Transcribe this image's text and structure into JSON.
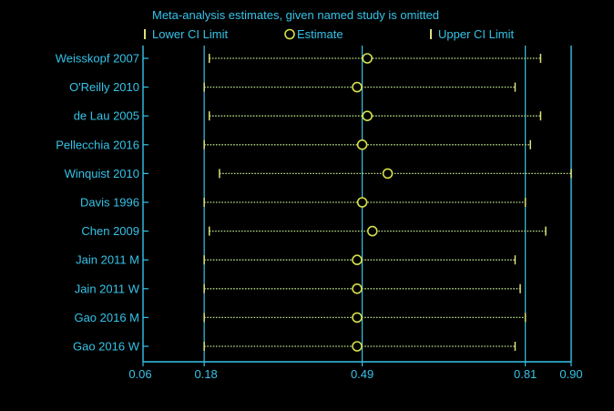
{
  "chart_data": {
    "type": "scatter",
    "title": "Meta-analysis estimates, given named study is omitted",
    "legend": {
      "placement": "top",
      "items": [
        {
          "label": "Lower CI Limit",
          "marker": "tick"
        },
        {
          "label": "Estimate",
          "marker": "circle"
        },
        {
          "label": "Upper CI Limit",
          "marker": "tick"
        }
      ]
    },
    "x_ticks": [
      {
        "value": 0.06,
        "label": "0.06"
      },
      {
        "value": 0.18,
        "label": "0.18"
      },
      {
        "value": 0.49,
        "label": "0.49"
      },
      {
        "value": 0.81,
        "label": "0.81"
      },
      {
        "value": 0.9,
        "label": "0.90"
      }
    ],
    "xlim": [
      0.06,
      0.9
    ],
    "reference_lines": [
      0.18,
      0.49,
      0.81
    ],
    "studies": [
      {
        "name": "Weisskopf 2007",
        "lower": 0.19,
        "estimate": 0.5,
        "upper": 0.84
      },
      {
        "name": "O'Reilly 2010",
        "lower": 0.18,
        "estimate": 0.48,
        "upper": 0.79
      },
      {
        "name": "de Lau 2005",
        "lower": 0.19,
        "estimate": 0.5,
        "upper": 0.84
      },
      {
        "name": "Pellecchia 2016",
        "lower": 0.18,
        "estimate": 0.49,
        "upper": 0.82
      },
      {
        "name": "Winquist 2010",
        "lower": 0.21,
        "estimate": 0.54,
        "upper": 0.9
      },
      {
        "name": "Davis 1996",
        "lower": 0.18,
        "estimate": 0.49,
        "upper": 0.81
      },
      {
        "name": "Chen 2009",
        "lower": 0.19,
        "estimate": 0.51,
        "upper": 0.85
      },
      {
        "name": "Jain 2011 M",
        "lower": 0.18,
        "estimate": 0.48,
        "upper": 0.79
      },
      {
        "name": "Jain 2011 W",
        "lower": 0.18,
        "estimate": 0.48,
        "upper": 0.8
      },
      {
        "name": "Gao 2016 M",
        "lower": 0.18,
        "estimate": 0.48,
        "upper": 0.81
      },
      {
        "name": "Gao 2016 W",
        "lower": 0.18,
        "estimate": 0.48,
        "upper": 0.79
      }
    ]
  },
  "colors": {
    "background": "#000000",
    "text": "#35c3e8",
    "axis": "#35c3e8",
    "ci_line": "#b9dd8a",
    "estimate": "#d6e04a",
    "ticks": "#dbe07a"
  }
}
